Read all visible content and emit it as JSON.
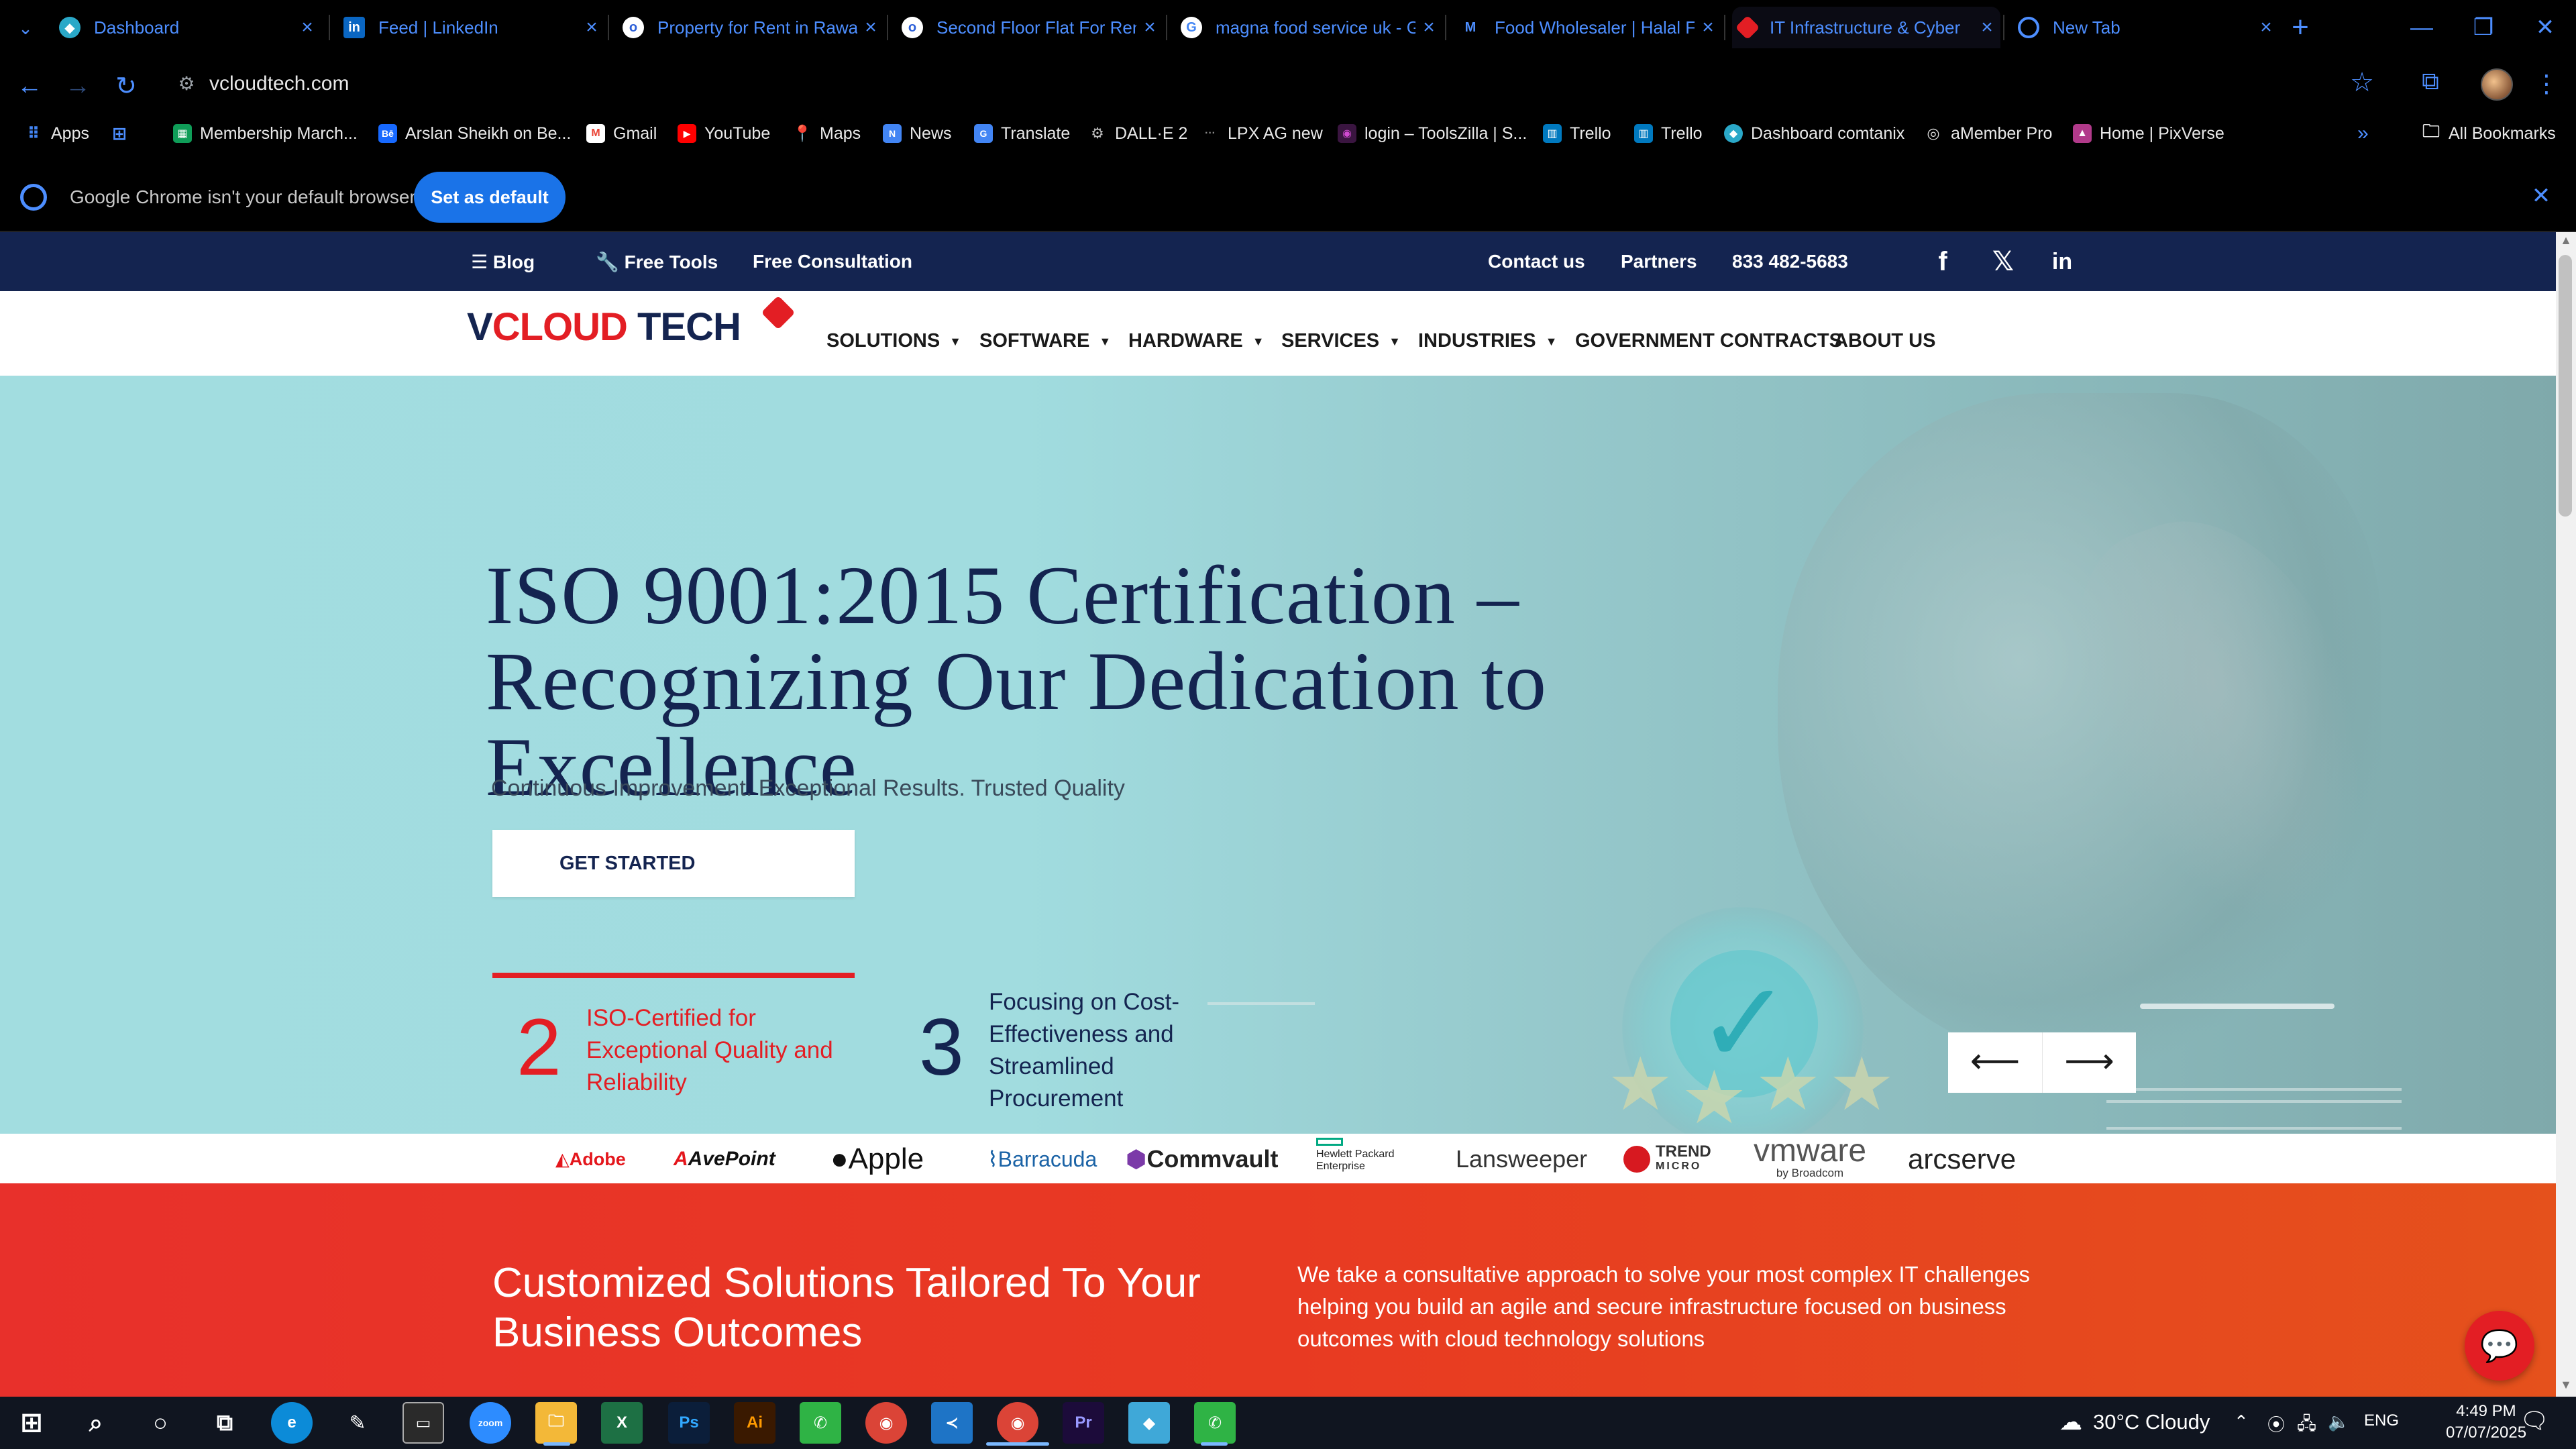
{
  "tabs": [
    {
      "label": "Dashboard",
      "icon": "globe-icon",
      "color": "#2aa8c8"
    },
    {
      "label": "Feed | LinkedIn",
      "icon": "linkedin-icon",
      "color": "#0a66c2"
    },
    {
      "label": "Property for Rent in Rawa",
      "icon": "olx-icon",
      "color": "#2c5fd8"
    },
    {
      "label": "Second Floor Flat For Ren",
      "icon": "olx-icon",
      "color": "#2c5fd8"
    },
    {
      "label": "magna food service uk - G",
      "icon": "google-icon",
      "color": "#4285f4"
    },
    {
      "label": "Food Wholesaler | Halal F",
      "icon": "m-icon",
      "color": "#0b6e99"
    },
    {
      "label": "IT Infrastructure & Cyber",
      "icon": "vcloud-icon",
      "color": "#e31e24"
    },
    {
      "label": "New Tab",
      "icon": "chrome-icon",
      "color": "#4d8eff"
    }
  ],
  "address": {
    "url": "vcloudtech.com"
  },
  "bookmarks": [
    {
      "label": "Apps",
      "icon": "apps-grid-icon",
      "color": "#4285f4"
    },
    {
      "label": "",
      "icon": "grid-icon",
      "color": "#4d8eff"
    },
    {
      "label": "Membership March...",
      "icon": "sheets-icon",
      "color": "#0f9d58"
    },
    {
      "label": "Arslan Sheikh on Be...",
      "icon": "behance-icon",
      "color": "#1769ff"
    },
    {
      "label": "Gmail",
      "icon": "gmail-icon",
      "color": "#ea4335"
    },
    {
      "label": "YouTube",
      "icon": "youtube-icon",
      "color": "#ff0000"
    },
    {
      "label": "Maps",
      "icon": "maps-icon",
      "color": "#34a853"
    },
    {
      "label": "News",
      "icon": "news-icon",
      "color": "#4285f4"
    },
    {
      "label": "Translate",
      "icon": "translate-icon",
      "color": "#4285f4"
    },
    {
      "label": "DALL·E 2",
      "icon": "openai-icon",
      "color": "#555555"
    },
    {
      "label": "LPX AG new",
      "icon": "dots-icon",
      "color": "#333333"
    },
    {
      "label": "login – ToolsZilla | S...",
      "icon": "toolszilla-icon",
      "color": "#7a2b8a"
    },
    {
      "label": "Trello",
      "icon": "trello-icon",
      "color": "#0079bf"
    },
    {
      "label": "Trello",
      "icon": "trello-icon",
      "color": "#0079bf"
    },
    {
      "label": "Dashboard comtanix",
      "icon": "globe-icon",
      "color": "#2aa8c8"
    },
    {
      "label": "aMember Pro",
      "icon": "amember-icon",
      "color": "#444444"
    },
    {
      "label": "Home | PixVerse",
      "icon": "pixverse-icon",
      "color": "#b13a8a"
    }
  ],
  "all_bookmarks": "All Bookmarks",
  "infobar": {
    "text": "Google Chrome isn't your default browser",
    "button": "Set as default"
  },
  "site": {
    "topbar": {
      "blog": "Blog",
      "free_tools": "Free Tools",
      "free_consultation": "Free Consultation",
      "contact": "Contact us",
      "partners": "Partners",
      "phone": "833 482-5683"
    },
    "logo": {
      "part1": "V",
      "part2": "CLOUD",
      "part3": " TECH"
    },
    "nav": [
      "SOLUTIONS",
      "SOFTWARE",
      "HARDWARE",
      "SERVICES",
      "INDUSTRIES",
      "GOVERNMENT CONTRACTS",
      "ABOUT US"
    ],
    "hero": {
      "title": "ISO 9001:2015 Certification – Recognizing Our Dedication to Excellence",
      "subtitle": "Continuous Improvement. Exceptional Results. Trusted Quality",
      "cta": "GET STARTED",
      "stats": [
        {
          "num": "2",
          "text": "ISO-Certified for Exceptional Quality and Reliability"
        },
        {
          "num": "3",
          "text": "Focusing on Cost-Effectiveness and Streamlined Procurement"
        }
      ]
    },
    "brands": [
      "Adobe",
      "AvePoint",
      "Apple",
      "Barracuda",
      "Commvault",
      "Hewlett Packard",
      "Enterprise",
      "Lansweeper",
      "TREND",
      "MICRO",
      "vmware",
      "by Broadcom",
      "arcserve"
    ],
    "solutions": {
      "title": "Customized Solutions Tailored To Your Business Outcomes",
      "desc": "We take a consultative approach to solve your most complex IT challenges helping you build an agile and secure infrastructure focused on business outcomes with cloud technology solutions"
    }
  },
  "taskbar": {
    "weather": "30°C  Cloudy",
    "lang": "ENG",
    "time": "4:49 PM",
    "date": "07/07/2025",
    "apps": [
      {
        "icon": "windows-start-icon",
        "color": "#101520"
      },
      {
        "icon": "search-icon",
        "color": "#101520"
      },
      {
        "icon": "cortana-icon",
        "color": "#101520"
      },
      {
        "icon": "task-view-icon",
        "color": "#101520"
      },
      {
        "icon": "edge-icon",
        "color": "#0c8bd8"
      },
      {
        "icon": "pen-icon",
        "color": "#101520"
      },
      {
        "icon": "terminal-icon",
        "color": "#2a2a2a"
      },
      {
        "icon": "zoom-icon",
        "color": "#2d8cff"
      },
      {
        "icon": "file-explorer-icon",
        "color": "#f3b838"
      },
      {
        "icon": "excel-icon",
        "color": "#1d7044"
      },
      {
        "icon": "photoshop-icon",
        "color": "#0b1e3a"
      },
      {
        "icon": "illustrator-icon",
        "color": "#3a1900"
      },
      {
        "icon": "whatsapp-like-icon",
        "color": "#2fb345"
      },
      {
        "icon": "chrome-icon",
        "color": "#db4437"
      },
      {
        "icon": "vscode-icon",
        "color": "#1e74c6"
      },
      {
        "icon": "chrome-active-icon",
        "color": "#db4437"
      },
      {
        "icon": "premiere-icon",
        "color": "#1c0b3a"
      },
      {
        "icon": "app-diamond-icon",
        "color": "#3fa8d8"
      },
      {
        "icon": "whatsapp-like-icon",
        "color": "#2fb345"
      }
    ]
  }
}
